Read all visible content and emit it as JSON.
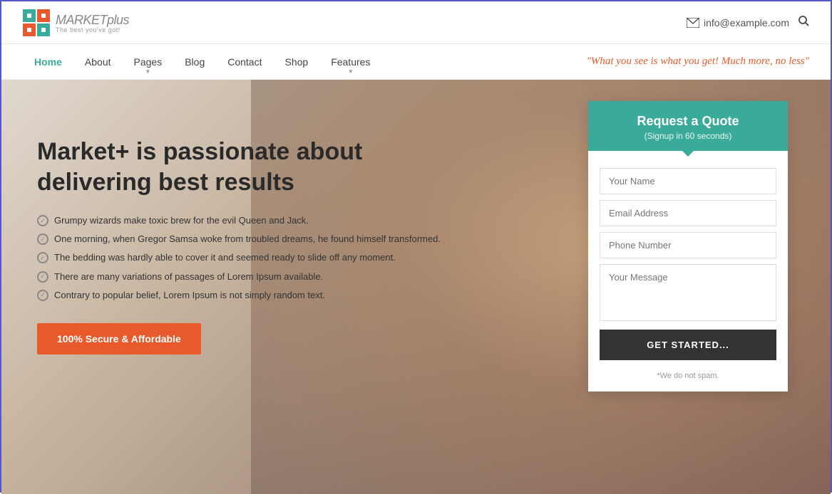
{
  "topbar": {
    "email": "info@example.com",
    "search_label": "search"
  },
  "logo": {
    "main": "MARKET",
    "suffix": "plus",
    "sub": "The best you've got!"
  },
  "nav": {
    "items": [
      {
        "label": "Home",
        "active": true,
        "has_dropdown": false
      },
      {
        "label": "About",
        "active": false,
        "has_dropdown": false
      },
      {
        "label": "Pages",
        "active": false,
        "has_dropdown": true
      },
      {
        "label": "Blog",
        "active": false,
        "has_dropdown": false
      },
      {
        "label": "Contact",
        "active": false,
        "has_dropdown": false
      },
      {
        "label": "Shop",
        "active": false,
        "has_dropdown": false
      },
      {
        "label": "Features",
        "active": false,
        "has_dropdown": true
      }
    ],
    "tagline": "\"What you see is what you get! Much more, no less\""
  },
  "hero": {
    "headline": "Market+ is passionate about delivering best results",
    "list_items": [
      "Grumpy wizards make toxic brew for the evil Queen and Jack.",
      "One morning, when Gregor Samsa woke from troubled dreams, he found himself transformed.",
      "The bedding was hardly able to cover it and seemed ready to slide off any moment.",
      "There are many variations of passages of Lorem Ipsum available.",
      "Contrary to popular belief, Lorem Ipsum is not simply random text."
    ],
    "cta_label": "100% Secure & Affordable"
  },
  "quote_form": {
    "title": "Request a Quote",
    "subtitle": "(Signup in 60 seconds)",
    "name_placeholder": "Your Name",
    "email_placeholder": "Email Address",
    "phone_placeholder": "Phone Number",
    "message_placeholder": "Your Message",
    "submit_label": "GET STARTED...",
    "spam_note": "*We do not spam."
  },
  "colors": {
    "accent_teal": "#3aab9a",
    "accent_orange": "#e85a2b",
    "nav_active": "#3aab9a"
  }
}
